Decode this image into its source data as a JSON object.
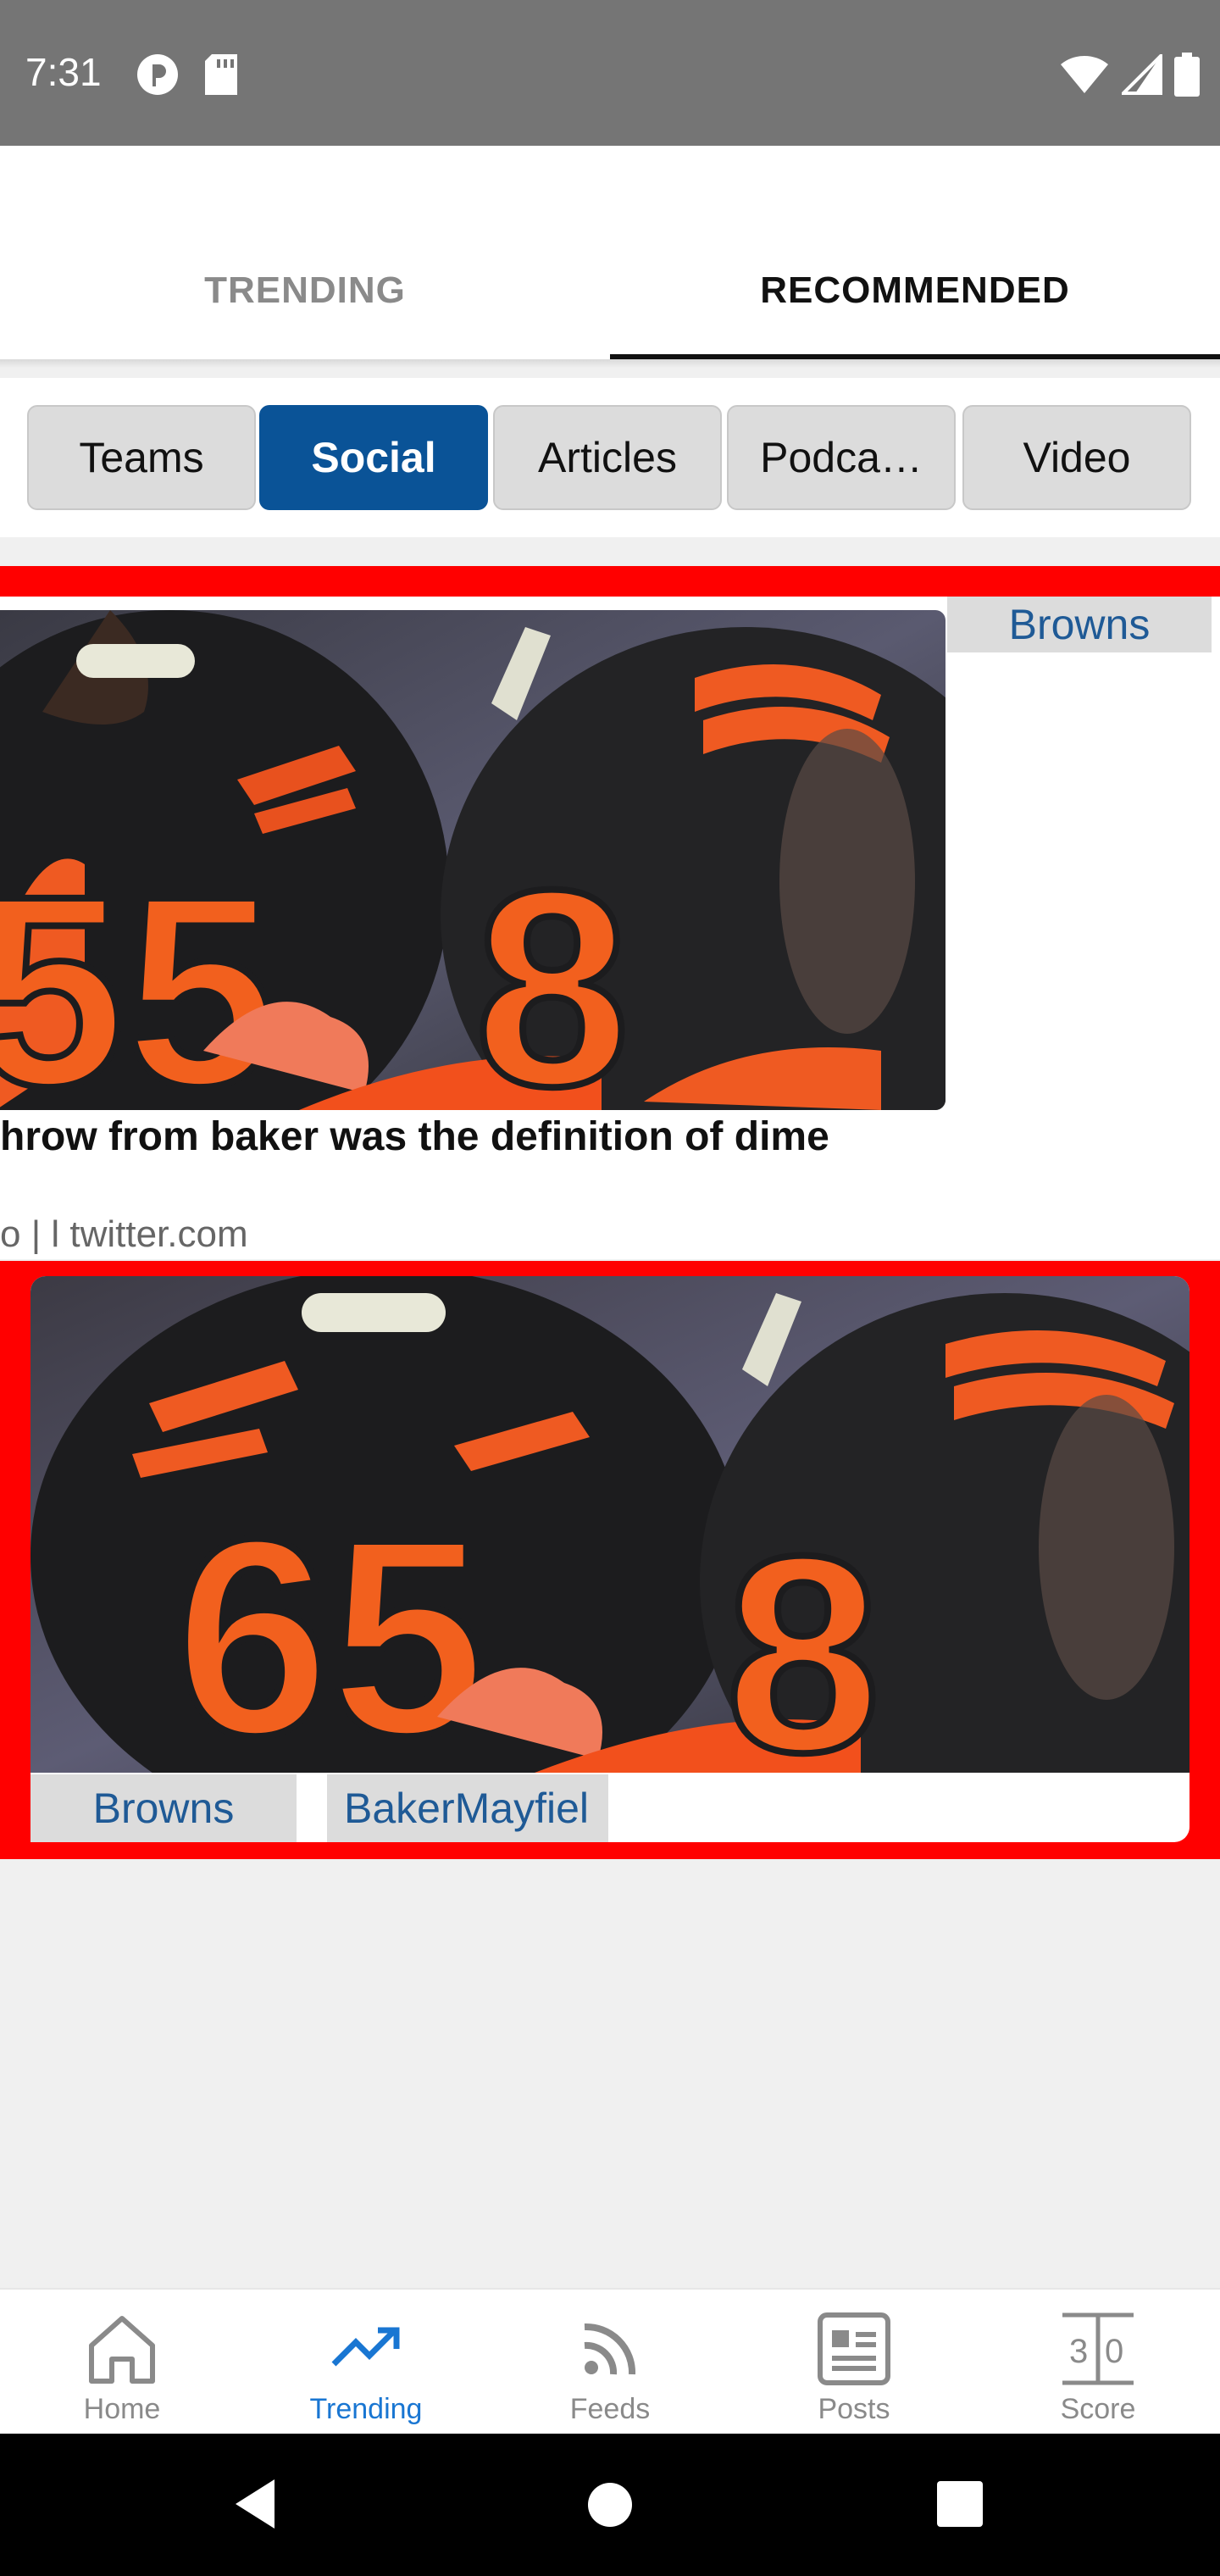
{
  "status_bar": {
    "time": "7:31"
  },
  "tabs": [
    {
      "label": "TRENDING",
      "selected": false
    },
    {
      "label": "RECOMMENDED",
      "selected": true
    }
  ],
  "chips": [
    {
      "label": "Teams",
      "selected": false
    },
    {
      "label": "Social",
      "selected": true
    },
    {
      "label": "Articles",
      "selected": false
    },
    {
      "label": "Podca…",
      "selected": false
    },
    {
      "label": "Video",
      "selected": false
    }
  ],
  "card1": {
    "tag": "Browns",
    "headline": "hrow from baker was the definition of dime",
    "source": "o | l  twitter.com"
  },
  "card2": {
    "tags": [
      "Browns",
      "BakerMayfiel"
    ]
  },
  "bottom_nav": [
    {
      "label": "Home",
      "icon": "home-icon",
      "active": false
    },
    {
      "label": "Trending",
      "icon": "trending-icon",
      "active": true
    },
    {
      "label": "Feeds",
      "icon": "rss-icon",
      "active": false
    },
    {
      "label": "Posts",
      "icon": "posts-icon",
      "active": false
    },
    {
      "label": "Score",
      "icon": "score-icon",
      "active": false
    }
  ],
  "colors": {
    "accent": "#0a5397",
    "nav_active": "#1976d2",
    "card_border": "#ff0000"
  }
}
